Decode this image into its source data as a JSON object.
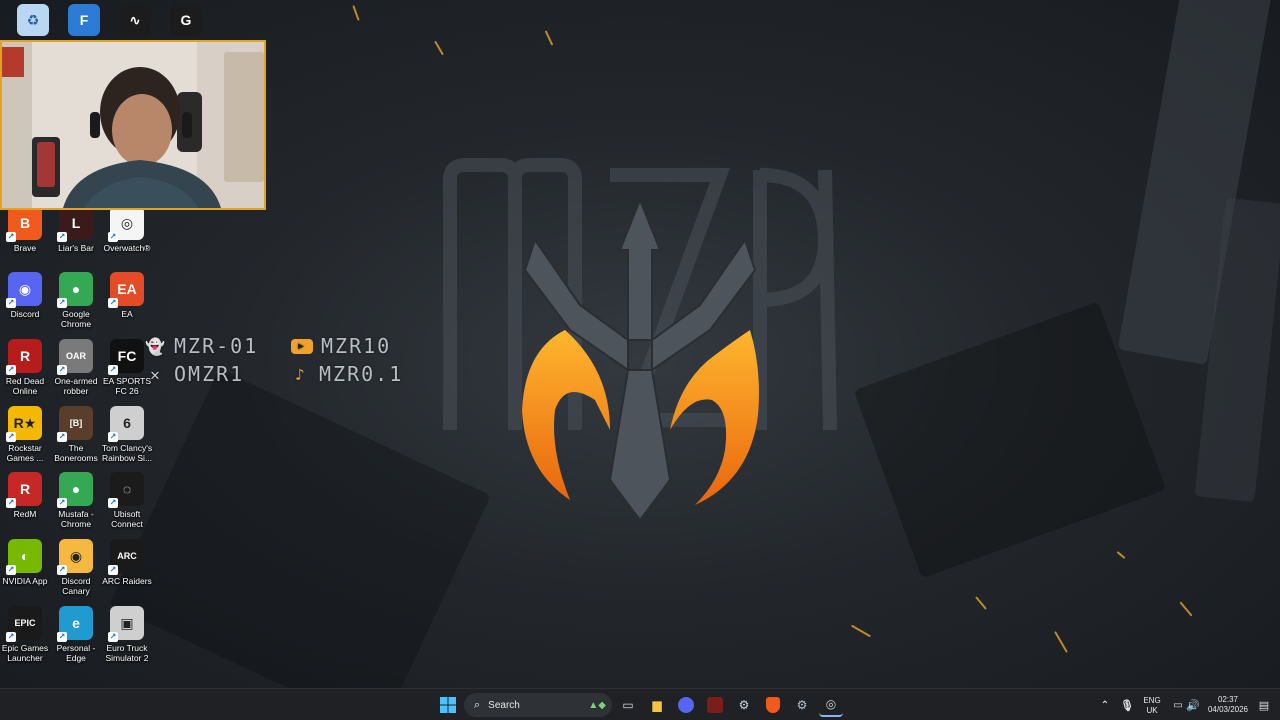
{
  "desktop": {
    "social": {
      "snapchat": "MZR-01",
      "youtube": "MZR10",
      "x": "OMZR1",
      "tiktok": "MZR0.1"
    },
    "icons": [
      {
        "label": "Brave",
        "icon": "brave-icon",
        "color": "#f25a1d",
        "glyph": "B"
      },
      {
        "label": "Liar's Bar",
        "icon": "liars-bar-icon",
        "color": "#3a1a1a",
        "glyph": "L"
      },
      {
        "label": "Overwatch®",
        "icon": "overwatch-icon",
        "color": "#f5f5f5",
        "glyph": "◎"
      },
      {
        "label": "Discord",
        "icon": "discord-icon",
        "color": "#5865f2",
        "glyph": "◉"
      },
      {
        "label": "Google Chrome",
        "icon": "chrome-icon",
        "color": "#34a853",
        "glyph": "●"
      },
      {
        "label": "EA",
        "icon": "ea-icon",
        "color": "#e44b27",
        "glyph": "EA"
      },
      {
        "label": "Red Dead Online",
        "icon": "red-dead-online-icon",
        "color": "#b71c1c",
        "glyph": "R"
      },
      {
        "label": "One-armed robber",
        "icon": "one-armed-robber-icon",
        "color": "#7a7a7a",
        "glyph": "OAR"
      },
      {
        "label": "EA SPORTS FC 26",
        "icon": "ea-sports-fc-icon",
        "color": "#111111",
        "glyph": "FC"
      },
      {
        "label": "Rockstar Games ...",
        "icon": "rockstar-icon",
        "color": "#f5b800",
        "glyph": "R★"
      },
      {
        "label": "The Bonerooms",
        "icon": "bonerooms-icon",
        "color": "#5a3e2b",
        "glyph": "[B]"
      },
      {
        "label": "Tom Clancy's Rainbow Si...",
        "icon": "rainbow-six-icon",
        "color": "#cfcfcf",
        "glyph": "6"
      },
      {
        "label": "RedM",
        "icon": "redm-icon",
        "color": "#c62828",
        "glyph": "R"
      },
      {
        "label": "Mustafa - Chrome",
        "icon": "chrome-profile-icon",
        "color": "#34a853",
        "glyph": "●"
      },
      {
        "label": "Ubisoft Connect",
        "icon": "ubisoft-icon",
        "color": "#1b1b1b",
        "glyph": "◌"
      },
      {
        "label": "NVIDIA App",
        "icon": "nvidia-icon",
        "color": "#76b900",
        "glyph": "◐"
      },
      {
        "label": "Discord Canary",
        "icon": "discord-canary-icon",
        "color": "#f5b942",
        "glyph": "◉"
      },
      {
        "label": "ARC Raiders",
        "icon": "arc-raiders-icon",
        "color": "#1a1a1a",
        "glyph": "ARC"
      },
      {
        "label": "Epic Games Launcher",
        "icon": "epic-games-icon",
        "color": "#1a1a1a",
        "glyph": "EPIC"
      },
      {
        "label": "Personal - Edge",
        "icon": "edge-icon",
        "color": "#1f9bd1",
        "glyph": "e"
      },
      {
        "label": "Euro Truck Simulator 2",
        "icon": "euro-truck-icon",
        "color": "#cfcfcf",
        "glyph": "▣"
      }
    ],
    "top_icons": [
      {
        "icon": "recycle-bin-icon",
        "color": "#b9d6f2",
        "glyph": "♻"
      },
      {
        "icon": "fortnite-icon",
        "color": "#2e7bd6",
        "glyph": "F"
      },
      {
        "icon": "waveform-app-icon",
        "color": "#1c1c1c",
        "glyph": "∿"
      },
      {
        "icon": "logitech-g-icon",
        "color": "#1c1c1c",
        "glyph": "G"
      }
    ]
  },
  "taskbar": {
    "search_placeholder": "Search",
    "language_line1": "ENG",
    "language_line2": "UK",
    "time": "02:37",
    "date": "04/03/2026",
    "accent": "#e4a221"
  }
}
